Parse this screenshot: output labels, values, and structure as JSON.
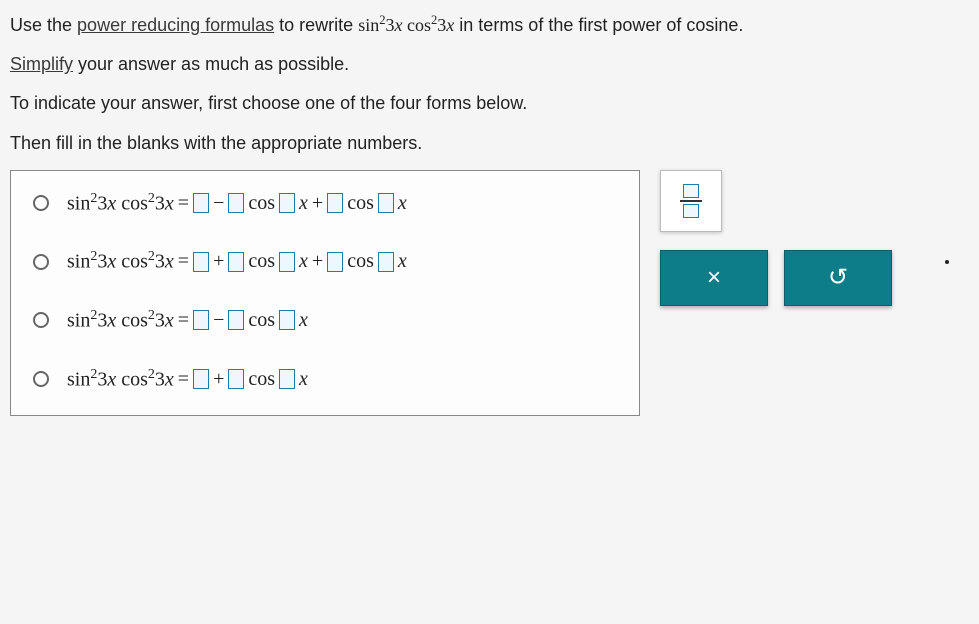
{
  "intro": {
    "line1_pre": "Use the ",
    "line1_link": "power reducing formulas",
    "line1_mid": " to rewrite ",
    "line1_expr": "sin²3x cos²3x",
    "line1_post": " in terms of the first power of cosine.",
    "line2_link": "Simplify",
    "line2_post": " your answer as much as possible.",
    "line3": "To indicate your answer, first choose one of the four forms below.",
    "line4": "Then fill in the blanks with the appropriate numbers."
  },
  "lhs": "sin²3x cos²3x",
  "eq": "=",
  "minus": "−",
  "plus": "+",
  "cos": "cos",
  "xvar": "x",
  "buttons": {
    "close": "×",
    "reset": "↺"
  }
}
